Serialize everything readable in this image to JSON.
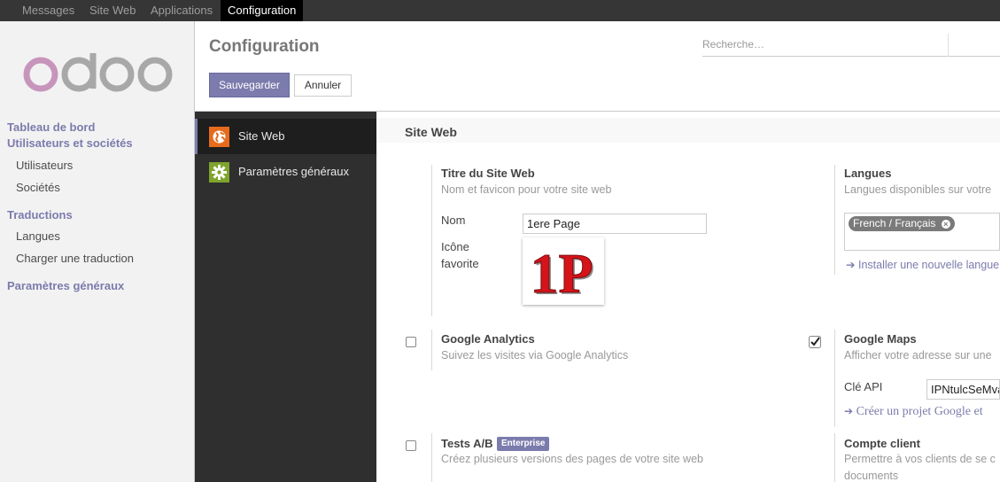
{
  "topbar": {
    "menus": [
      "Messages",
      "Site Web",
      "Applications",
      "Configuration"
    ]
  },
  "sidebar": {
    "logo_text": "odoo",
    "items": [
      {
        "label": "Tableau de bord",
        "type": "head"
      },
      {
        "label": "Utilisateurs et sociétés",
        "type": "head"
      },
      {
        "label": "Utilisateurs",
        "type": "sub"
      },
      {
        "label": "Sociétés",
        "type": "sub"
      },
      {
        "label": "Traductions",
        "type": "head"
      },
      {
        "label": "Langues",
        "type": "sub"
      },
      {
        "label": "Charger une traduction",
        "type": "sub"
      },
      {
        "label": "Paramètres généraux",
        "type": "head"
      }
    ]
  },
  "control_panel": {
    "title": "Configuration",
    "search_placeholder": "Recherche…",
    "save_label": "Sauvegarder",
    "cancel_label": "Annuler"
  },
  "settings_nav": {
    "items": [
      {
        "label": "Site Web",
        "icon": "globe-icon",
        "active": true
      },
      {
        "label": "Paramètres généraux",
        "icon": "gear-icon",
        "active": false
      }
    ]
  },
  "content": {
    "section_title": "Site Web",
    "site_title": {
      "title": "Titre du Site Web",
      "desc": "Nom et favicon pour votre site web",
      "name_label": "Nom",
      "name_value": "1ere Page",
      "favicon_label_1": "Icône",
      "favicon_label_2": "favorite",
      "favicon_text": "1P"
    },
    "languages": {
      "title": "Langues",
      "desc": "Langues disponibles sur votre",
      "tag": "French / Français",
      "install_link": "Installer une nouvelle langue"
    },
    "google_analytics": {
      "title": "Google Analytics",
      "desc": "Suivez les visites via Google Analytics",
      "checked": false
    },
    "google_maps": {
      "title": "Google Maps",
      "desc": "Afficher votre adresse sur une",
      "api_label": "Clé API",
      "api_value": "IPNtulcSeMva",
      "create_link": "Créer un projet Google et",
      "checked": true
    },
    "ab_tests": {
      "title": "Tests A/B",
      "badge": "Enterprise",
      "desc": "Créez plusieurs versions des pages de votre site web",
      "checked": false
    },
    "customer_account": {
      "title": "Compte client",
      "desc_1": "Permettre à vos clients de se c",
      "desc_2": "documents"
    }
  },
  "colors": {
    "brand": "#7c7bad",
    "topbar": "#363636",
    "settings_nav": "#2f2f2f"
  }
}
